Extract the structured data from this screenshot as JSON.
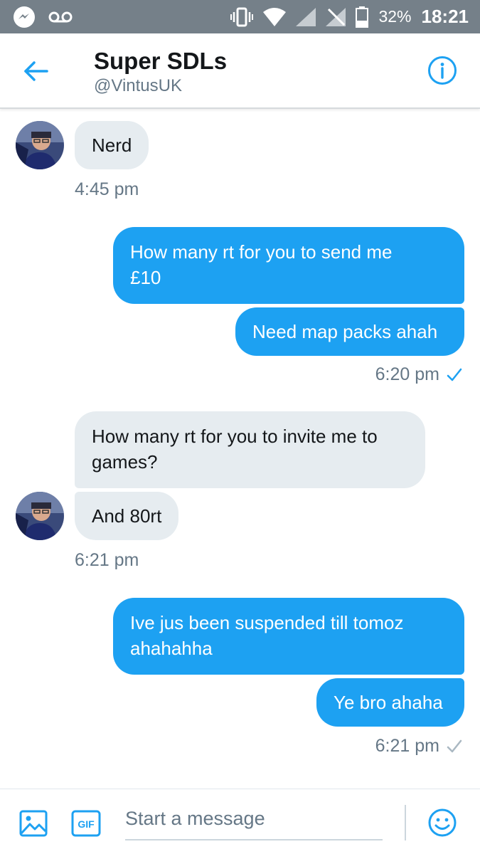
{
  "status_bar": {
    "battery": "32%",
    "time": "18:21"
  },
  "header": {
    "title": "Super SDLs",
    "handle": "@VintusUK"
  },
  "messages": [
    {
      "side": "in",
      "text": "Nerd"
    },
    {
      "side": "in",
      "timestamp": "4:45 pm"
    },
    {
      "side": "out",
      "lines": [
        "How many rt for you to send me",
        "£10"
      ]
    },
    {
      "side": "out",
      "text": "Need map packs ahah"
    },
    {
      "side": "out",
      "timestamp": "6:20 pm",
      "status": "read"
    },
    {
      "side": "in",
      "lines": [
        "How many rt for you to invite me to",
        "games?"
      ]
    },
    {
      "side": "in",
      "text": "And 80rt"
    },
    {
      "side": "in",
      "timestamp": "6:21 pm"
    },
    {
      "side": "out",
      "lines": [
        "Ive jus been suspended till tomoz",
        "ahahahha"
      ]
    },
    {
      "side": "out",
      "text": "Ye bro ahaha"
    },
    {
      "side": "out",
      "timestamp": "6:21 pm",
      "status": "sent"
    }
  ],
  "composer": {
    "placeholder": "Start a message",
    "gif_label": "GIF"
  },
  "colors": {
    "accent": "#1da1f2",
    "incoming_bubble": "#e6ecf0",
    "status_bar": "#758089"
  },
  "icons": [
    "messenger-icon",
    "voicemail-icon",
    "vibrate-icon",
    "wifi-icon",
    "signal-icon",
    "no-signal-icon",
    "battery-icon",
    "back-arrow-icon",
    "info-icon",
    "image-icon",
    "gif-icon",
    "emoji-icon",
    "check-icon"
  ]
}
